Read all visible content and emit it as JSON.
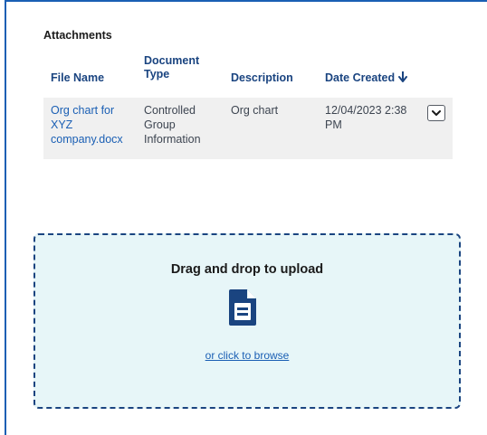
{
  "attachments": {
    "title": "Attachments",
    "columns": {
      "file_name": "File Name",
      "document_type": "Document\nType",
      "description": "Description",
      "date_created": "Date Created"
    },
    "rows": [
      {
        "file_name": "Org chart for\nXYZ\ncompany.docx",
        "document_type": "Controlled\nGroup\nInformation",
        "description": "Org chart",
        "date_created": "12/04/2023 2:38\nPM"
      }
    ],
    "sort": {
      "column": "date_created",
      "direction": "descending",
      "icon": "arrow-down-icon"
    },
    "row_action_icon": "chevron-down-icon"
  },
  "upload": {
    "title": "Drag and drop to upload",
    "icon": "document-icon",
    "browse_link": "or click to browse"
  },
  "colors": {
    "accent": "#1a5fb4",
    "header_text": "#1a4480",
    "row_background": "#f0f0f0",
    "dropzone_background": "#e7f6f8",
    "dropzone_border": "#1a4480",
    "icon": "#1a4480"
  }
}
